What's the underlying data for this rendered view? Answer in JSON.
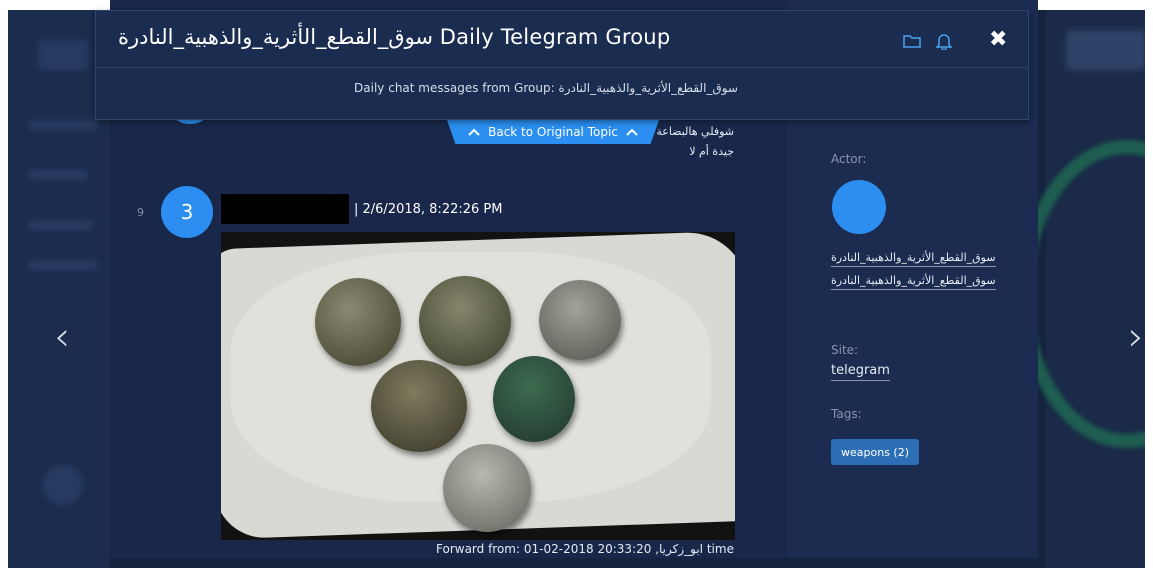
{
  "modal": {
    "title": "سوق_القطع_الأثرية_والذهبية_النادرة Daily Telegram Group",
    "subtitle": "Daily chat messages from Group: سوق_القطع_الأثرية_والذهبية_النادرة"
  },
  "header_icons": [
    "folder-icon",
    "bell-icon",
    "close-icon"
  ],
  "back_button": {
    "label": "Back to Original Topic"
  },
  "previous_message": {
    "lines": [
      "شوفلي هالبضاعة",
      "جيدة أم لا"
    ]
  },
  "message": {
    "index": "9",
    "avatar_number": "3",
    "timestamp": "| 2/6/2018, 8:22:26 PM",
    "forward_line": "Forward from: ابو_زكريا, 20:33:20 2018-02-01 time"
  },
  "details": {
    "actor_label": "Actor:",
    "actor_names": [
      "سوق_القطع_الأثرية_والذهبية_النادرة",
      "سوق_القطع_الأثرية_والذهبية_النادرة"
    ],
    "site_label": "Site:",
    "site_value": "telegram",
    "tags_label": "Tags:",
    "tag": "weapons (2)"
  },
  "nav": {
    "prev": "‹",
    "next": "›"
  },
  "colors": {
    "accent": "#2c8ef0",
    "panel": "#19284a",
    "tag": "#2c6fb6"
  }
}
